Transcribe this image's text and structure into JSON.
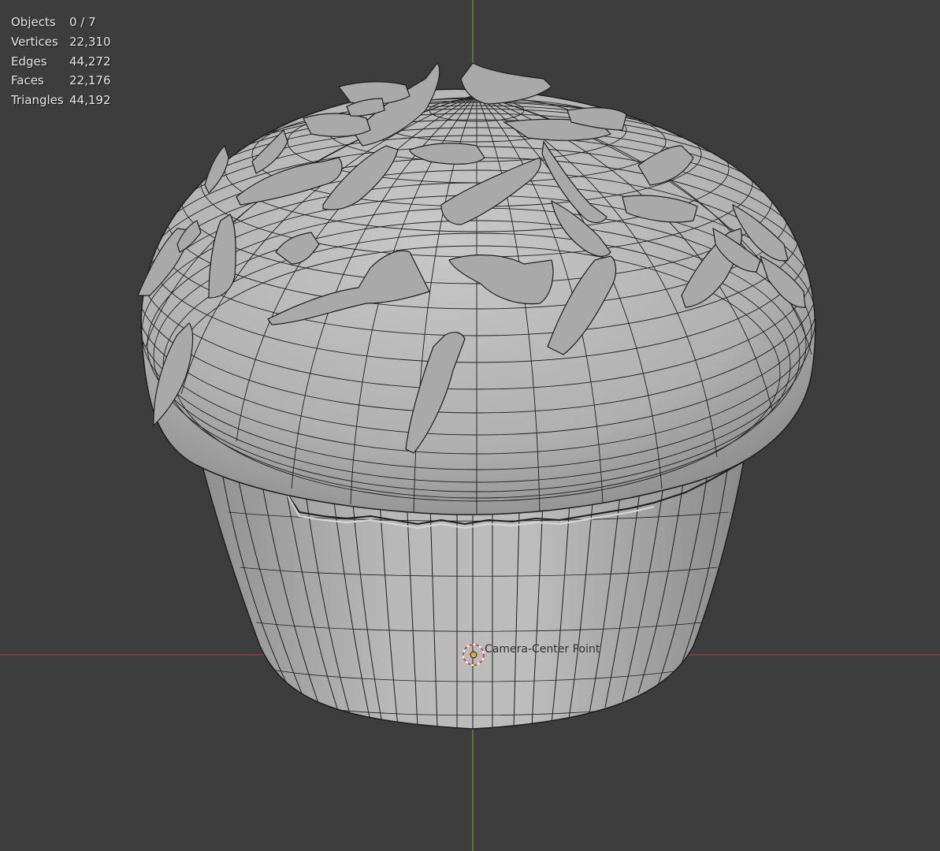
{
  "viewport": {
    "background": "#3d3d3d",
    "x_axis_color": "#9b3a3a",
    "y_axis_color": "#5e8c2f"
  },
  "stats": [
    {
      "label": "Objects",
      "value": "0 / 7"
    },
    {
      "label": "Vertices",
      "value": "22,310"
    },
    {
      "label": "Edges",
      "value": "44,272"
    },
    {
      "label": "Faces",
      "value": "22,176"
    },
    {
      "label": "Triangles",
      "value": "44,192"
    }
  ],
  "scene": {
    "model_color": "#b4b4b4",
    "wire_color": "#1e1e1e",
    "camera_label": "Camera-Center Point",
    "camera_marker_color": "#e04040",
    "origin_dot_color": "#f0a030"
  }
}
